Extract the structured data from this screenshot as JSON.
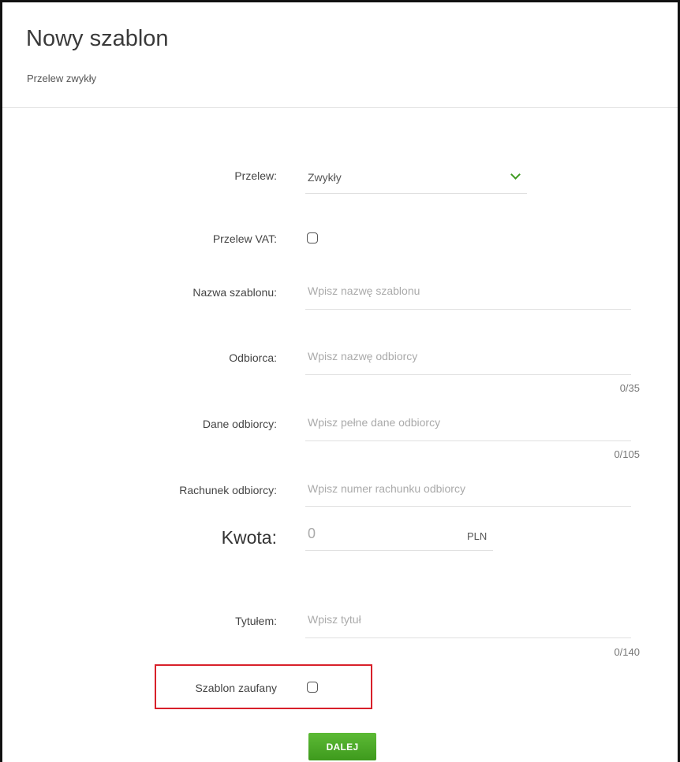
{
  "header": {
    "title": "Nowy szablon",
    "subtitle": "Przelew zwykły"
  },
  "form": {
    "przelew": {
      "label": "Przelew:",
      "value": "Zwykły"
    },
    "vat": {
      "label": "Przelew VAT:",
      "checked": false
    },
    "nazwa": {
      "label": "Nazwa szablonu:",
      "placeholder": "Wpisz nazwę szablonu"
    },
    "odbiorca": {
      "label": "Odbiorca:",
      "placeholder": "Wpisz nazwę odbiorcy",
      "counter": "0/35"
    },
    "dane": {
      "label": "Dane odbiorcy:",
      "placeholder": "Wpisz pełne dane odbiorcy",
      "counter": "0/105"
    },
    "rachunek": {
      "label": "Rachunek odbiorcy:",
      "placeholder": "Wpisz numer rachunku odbiorcy"
    },
    "kwota": {
      "label": "Kwota:",
      "placeholder": "0",
      "currency": "PLN"
    },
    "tytul": {
      "label": "Tytułem:",
      "placeholder": "Wpisz tytuł",
      "counter": "0/140"
    },
    "zaufany": {
      "label": "Szablon zaufany",
      "checked": false
    }
  },
  "actions": {
    "next_label": "DALEJ"
  },
  "colors": {
    "accent": "#49a827",
    "highlight": "#d8202a"
  },
  "icons": {
    "dropdown": "chevron-down-icon"
  }
}
